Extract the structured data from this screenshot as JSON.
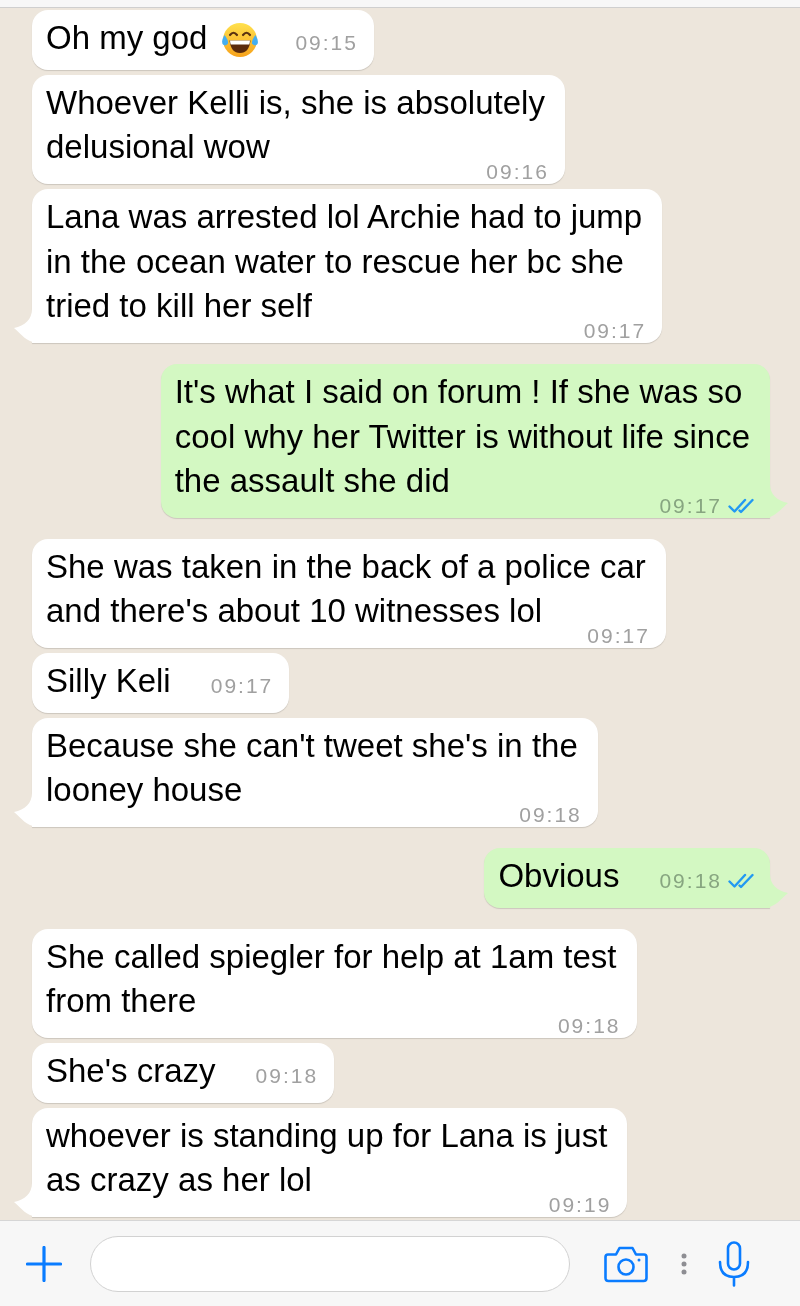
{
  "messages": [
    {
      "kind": "incoming",
      "lines": [
        "Oh my god"
      ],
      "emoji": true,
      "time": "09:15"
    },
    {
      "kind": "incoming",
      "lines": [
        "Whoever Kelli is, she is absolutely",
        "delusional wow"
      ],
      "emoji": false,
      "time": "09:16"
    },
    {
      "kind": "incoming",
      "lines": [
        "Lana was arrested lol Archie had to jump",
        "in the ocean water to rescue her bc she",
        "tried to kill her self"
      ],
      "emoji": false,
      "time": "09:17"
    },
    {
      "kind": "outgoing",
      "lines": [
        "It's what I said on forum ! If she was so",
        "cool why her Twitter is without life since",
        "the assault she did"
      ],
      "emoji": false,
      "time": "09:17",
      "read": true
    },
    {
      "kind": "incoming",
      "lines": [
        "She was taken in the back of a police car",
        "and there's about 10 witnesses lol"
      ],
      "emoji": false,
      "time": "09:17"
    },
    {
      "kind": "incoming",
      "lines": [
        "Silly Keli"
      ],
      "emoji": false,
      "time": "09:17"
    },
    {
      "kind": "incoming",
      "lines": [
        "Because she can't tweet she's in the",
        "looney house"
      ],
      "emoji": false,
      "time": "09:18"
    },
    {
      "kind": "outgoing",
      "lines": [
        "Obvious"
      ],
      "emoji": false,
      "time": "09:18",
      "read": true
    },
    {
      "kind": "incoming",
      "lines": [
        "She called spiegler for help at 1am test",
        "from there"
      ],
      "emoji": false,
      "time": "09:18"
    },
    {
      "kind": "incoming",
      "lines": [
        "She's crazy"
      ],
      "emoji": false,
      "time": "09:18"
    },
    {
      "kind": "incoming",
      "lines": [
        "whoever is standing up for Lana is just",
        "as crazy as her lol"
      ],
      "emoji": false,
      "time": "09:19"
    }
  ]
}
